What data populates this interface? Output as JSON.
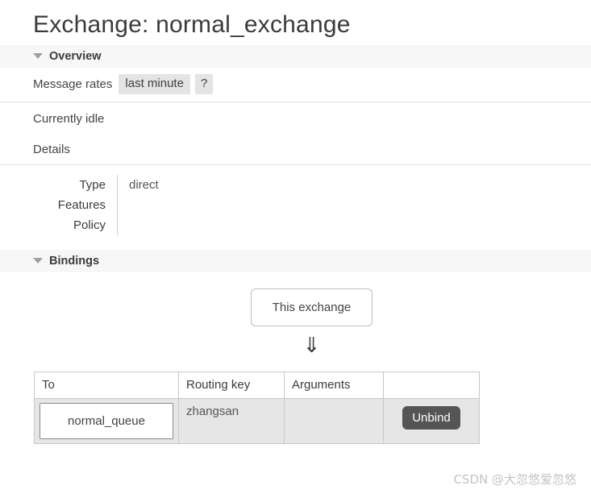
{
  "page": {
    "title": "Exchange: normal_exchange"
  },
  "overview": {
    "section_label": "Overview",
    "caret_icon": "caret-down-icon",
    "message_rates_label": "Message rates",
    "rate_period_tab": "last minute",
    "help_tab": "?",
    "idle_text": "Currently idle",
    "details_label": "Details",
    "details": [
      {
        "key": "Type",
        "value": "direct"
      },
      {
        "key": "Features",
        "value": ""
      },
      {
        "key": "Policy",
        "value": ""
      }
    ]
  },
  "bindings": {
    "section_label": "Bindings",
    "caret_icon": "caret-down-icon",
    "source_box_label": "This exchange",
    "arrow_glyph": "⇓",
    "columns": [
      "To",
      "Routing key",
      "Arguments",
      ""
    ],
    "rows": [
      {
        "to": "normal_queue",
        "routing_key": "zhangsan",
        "arguments": "",
        "action_label": "Unbind"
      }
    ]
  },
  "watermark": {
    "text": "CSDN @大忽悠爱忽悠"
  },
  "colors": {
    "section_bar_bg": "#f7f7f7",
    "tab_chip_bg": "#e4e4e4",
    "table_row_bg": "#e6e6e6",
    "unbind_button_bg": "#555555",
    "border": "#c8c8c8",
    "text": "#444444"
  }
}
